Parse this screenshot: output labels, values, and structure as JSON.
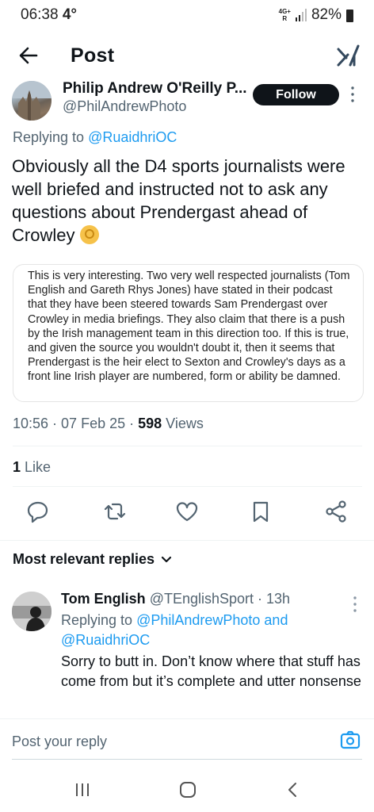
{
  "status_bar": {
    "time": "06:38",
    "temperature": "4°",
    "network_top": "4G+",
    "network_bottom": "R",
    "battery": "82%"
  },
  "header": {
    "title": "Post"
  },
  "post": {
    "author_name": "Philip Andrew O'Reilly P...",
    "author_handle": "@PhilAndrewPhoto",
    "follow_label": "Follow",
    "replying_prefix": "Replying to ",
    "replying_handle": "@RuaidhriOC",
    "text": "Obviously all the D4 sports journalists were well briefed and instructed not to ask any questions about Prendergast ahead of Crowley",
    "quoted_image_text": "This is very interesting. Two very well respected journalists (Tom English and Gareth Rhys Jones) have stated in their podcast that they have been steered towards Sam Prendergast over Crowley in media briefings. They also claim that there is a push by the Irish management team in this direction too. If this is true, and given the source you wouldn't doubt it, then it seems that Prendergast is the heir elect to Sexton and Crowley's days as a front line Irish player are numbered, form or ability be damned.",
    "time": "10:56",
    "date": "07 Feb 25",
    "views_count": "598",
    "views_label": "Views",
    "likes_count": "1",
    "likes_label": "Like"
  },
  "replies_section": {
    "filter_label": "Most relevant replies"
  },
  "reply": {
    "name": "Tom English",
    "handle": "@TEnglishSport",
    "age": "13h",
    "replying_prefix": "Replying to ",
    "replying_handles": "@PhilAndrewPhoto and @RuaidhriOC",
    "text": "Sorry to butt in. Don’t know where that stuff has come from but it’s complete and utter nonsense"
  },
  "composer": {
    "placeholder": "Post your reply"
  },
  "icons": {
    "reply": "reply-icon",
    "repost": "repost-icon",
    "like": "heart-icon",
    "bookmark": "bookmark-icon",
    "share": "share-icon",
    "camera": "camera-icon"
  },
  "colors": {
    "accent": "#1d9bf0",
    "text": "#0f1419",
    "secondary": "#536471"
  }
}
